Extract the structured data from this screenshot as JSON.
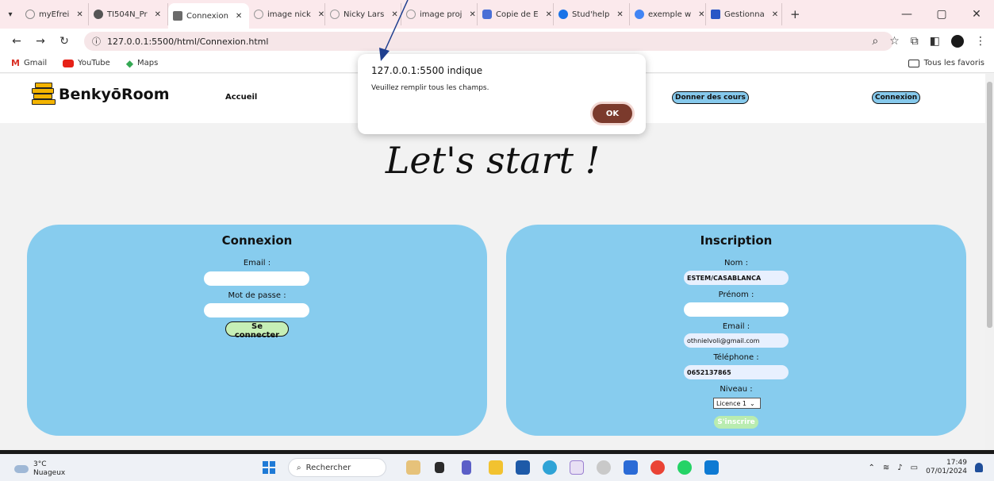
{
  "browser": {
    "tabs": [
      {
        "label": "myEfrei",
        "fav": "#888888"
      },
      {
        "label": "TI504N_Pr",
        "fav": "#555555"
      },
      {
        "label": "Connexion",
        "fav": "#6b6b6b",
        "active": true
      },
      {
        "label": "image nick",
        "fav": "#999999"
      },
      {
        "label": "Nicky Lars",
        "fav": "#999999"
      },
      {
        "label": "image proj",
        "fav": "#999999"
      },
      {
        "label": "Copie de E",
        "fav": "#4a6fd6"
      },
      {
        "label": "Stud'help",
        "fav": "#1a73e8"
      },
      {
        "label": "exemple w",
        "fav": "#4285f4"
      },
      {
        "label": "Gestionna",
        "fav": "#2a56c6"
      }
    ],
    "url": "127.0.0.1:5500/html/Connexion.html",
    "bookmarks": {
      "gmail": "Gmail",
      "youtube": "YouTube",
      "maps": "Maps",
      "all": "Tous les favoris"
    }
  },
  "site": {
    "logo": "BenkyōRoom",
    "nav": {
      "home": "Accueil",
      "teach": "Donner des cours",
      "login": "Connexion"
    },
    "hero": "Let's start !"
  },
  "login": {
    "title": "Connexion",
    "email_label": "Email :",
    "password_label": "Mot de passe :",
    "submit": "Se connecter"
  },
  "signup": {
    "title": "Inscription",
    "nom_label": "Nom :",
    "nom_value": "ESTEM/CASABLANCA",
    "prenom_label": "Prénom :",
    "email_label": "Email :",
    "email_value": "othnielvoli@gmail.com",
    "tel_label": "Téléphone :",
    "tel_value": "0652137865",
    "niveau_label": "Niveau :",
    "niveau_value": "Licence 1",
    "submit": "S'inscrire"
  },
  "dialog": {
    "title": "127.0.0.1:5500 indique",
    "message": "Veuillez remplir tous les champs.",
    "ok": "OK"
  },
  "taskbar": {
    "temp": "3°C",
    "weather": "Nuageux",
    "search": "Rechercher",
    "time": "17:49",
    "date": "07/01/2024"
  }
}
